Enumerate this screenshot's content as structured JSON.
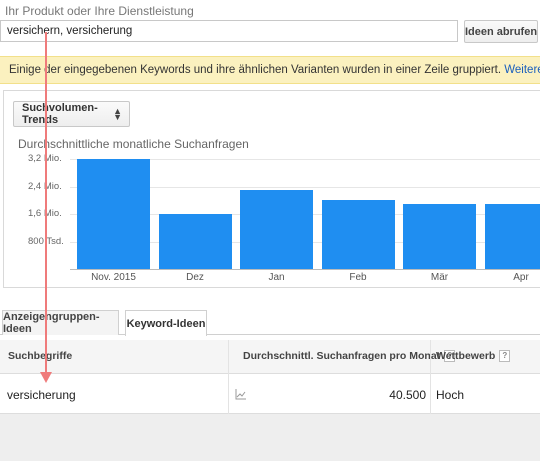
{
  "header": {
    "product_label": "Ihr Produkt oder Ihre Dienstleistung",
    "search_value": "versichern, versicherung",
    "get_ideas_label": "Ideen abrufen"
  },
  "notice": {
    "text": "Einige der eingegebenen Keywords und ihre ähnlichen Varianten wurden in einer Zeile gruppiert. ",
    "link": "Weitere Informationen"
  },
  "chart_panel": {
    "selector_label": "Suchvolumen-Trends"
  },
  "chart_data": {
    "type": "bar",
    "title": "Durchschnittliche monatliche Suchanfragen",
    "categories": [
      "Nov. 2015",
      "Dez",
      "Jan",
      "Feb",
      "Mär",
      "Apr"
    ],
    "values": [
      3200000,
      1600000,
      2300000,
      2000000,
      1900000,
      1900000
    ],
    "ytick_labels": [
      "3,2 Mio.",
      "2,4 Mio.",
      "1,6 Mio.",
      "800 Tsd."
    ],
    "ytick_values": [
      3200000,
      2400000,
      1600000,
      800000
    ],
    "ylim": [
      0,
      3200000
    ],
    "xlabel": "",
    "ylabel": "",
    "bar_color": "#1f8ef1",
    "grid": true
  },
  "tabs": [
    {
      "label": "Anzeigengruppen-Ideen",
      "active": false
    },
    {
      "label": "Keyword-Ideen",
      "active": true
    }
  ],
  "table": {
    "columns": [
      "Suchbegriffe",
      "Durchschnittl. Suchanfragen pro Monat",
      "Wettbewerb"
    ],
    "help_glyph": "?",
    "rows": [
      {
        "keyword": "versicherung",
        "monthly_searches": "40.500",
        "competition": "Hoch"
      }
    ]
  },
  "colors": {
    "accent_blue": "#1f8ef1",
    "notice_bg": "#fbf1bf",
    "arrow_color": "#ef7b7b",
    "link_color": "#1a5fbd"
  }
}
